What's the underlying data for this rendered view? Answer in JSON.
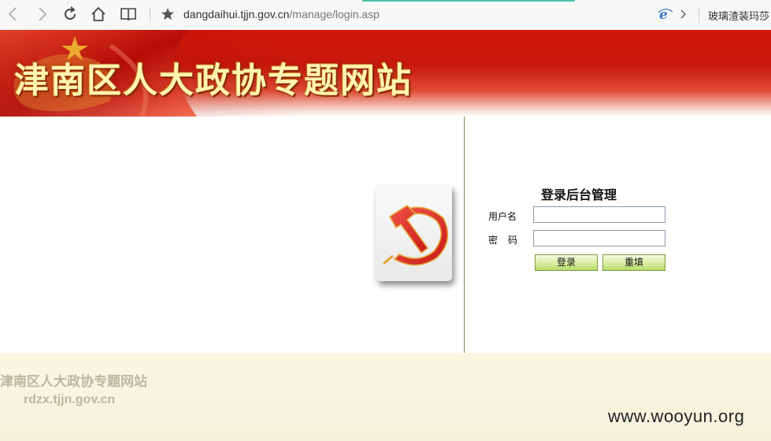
{
  "browser": {
    "url_host": "dangdaihui.tjjn.gov.cn",
    "url_path": "/manage/login.asp",
    "tab_snippet": "玻璃渣装玛莎"
  },
  "banner": {
    "title": "津南区人大政协专题网站"
  },
  "login": {
    "title": "登录后台管理",
    "username_label": "用户名",
    "username_value": "",
    "password_label": "密码",
    "password_value": "",
    "login_button": "登录",
    "reset_button": "重填"
  },
  "footer": {
    "site_name": "津南区人大政协专题网站",
    "domain": "rdzx.tjjn.gov.cn"
  },
  "watermark": "www.wooyun.org",
  "colors": {
    "banner_red": "#d1180a",
    "banner_text": "#fff3b0",
    "button_green": "#b7da6a",
    "divider": "#7a8a4a",
    "footer_bg": "#f7f7e4"
  }
}
